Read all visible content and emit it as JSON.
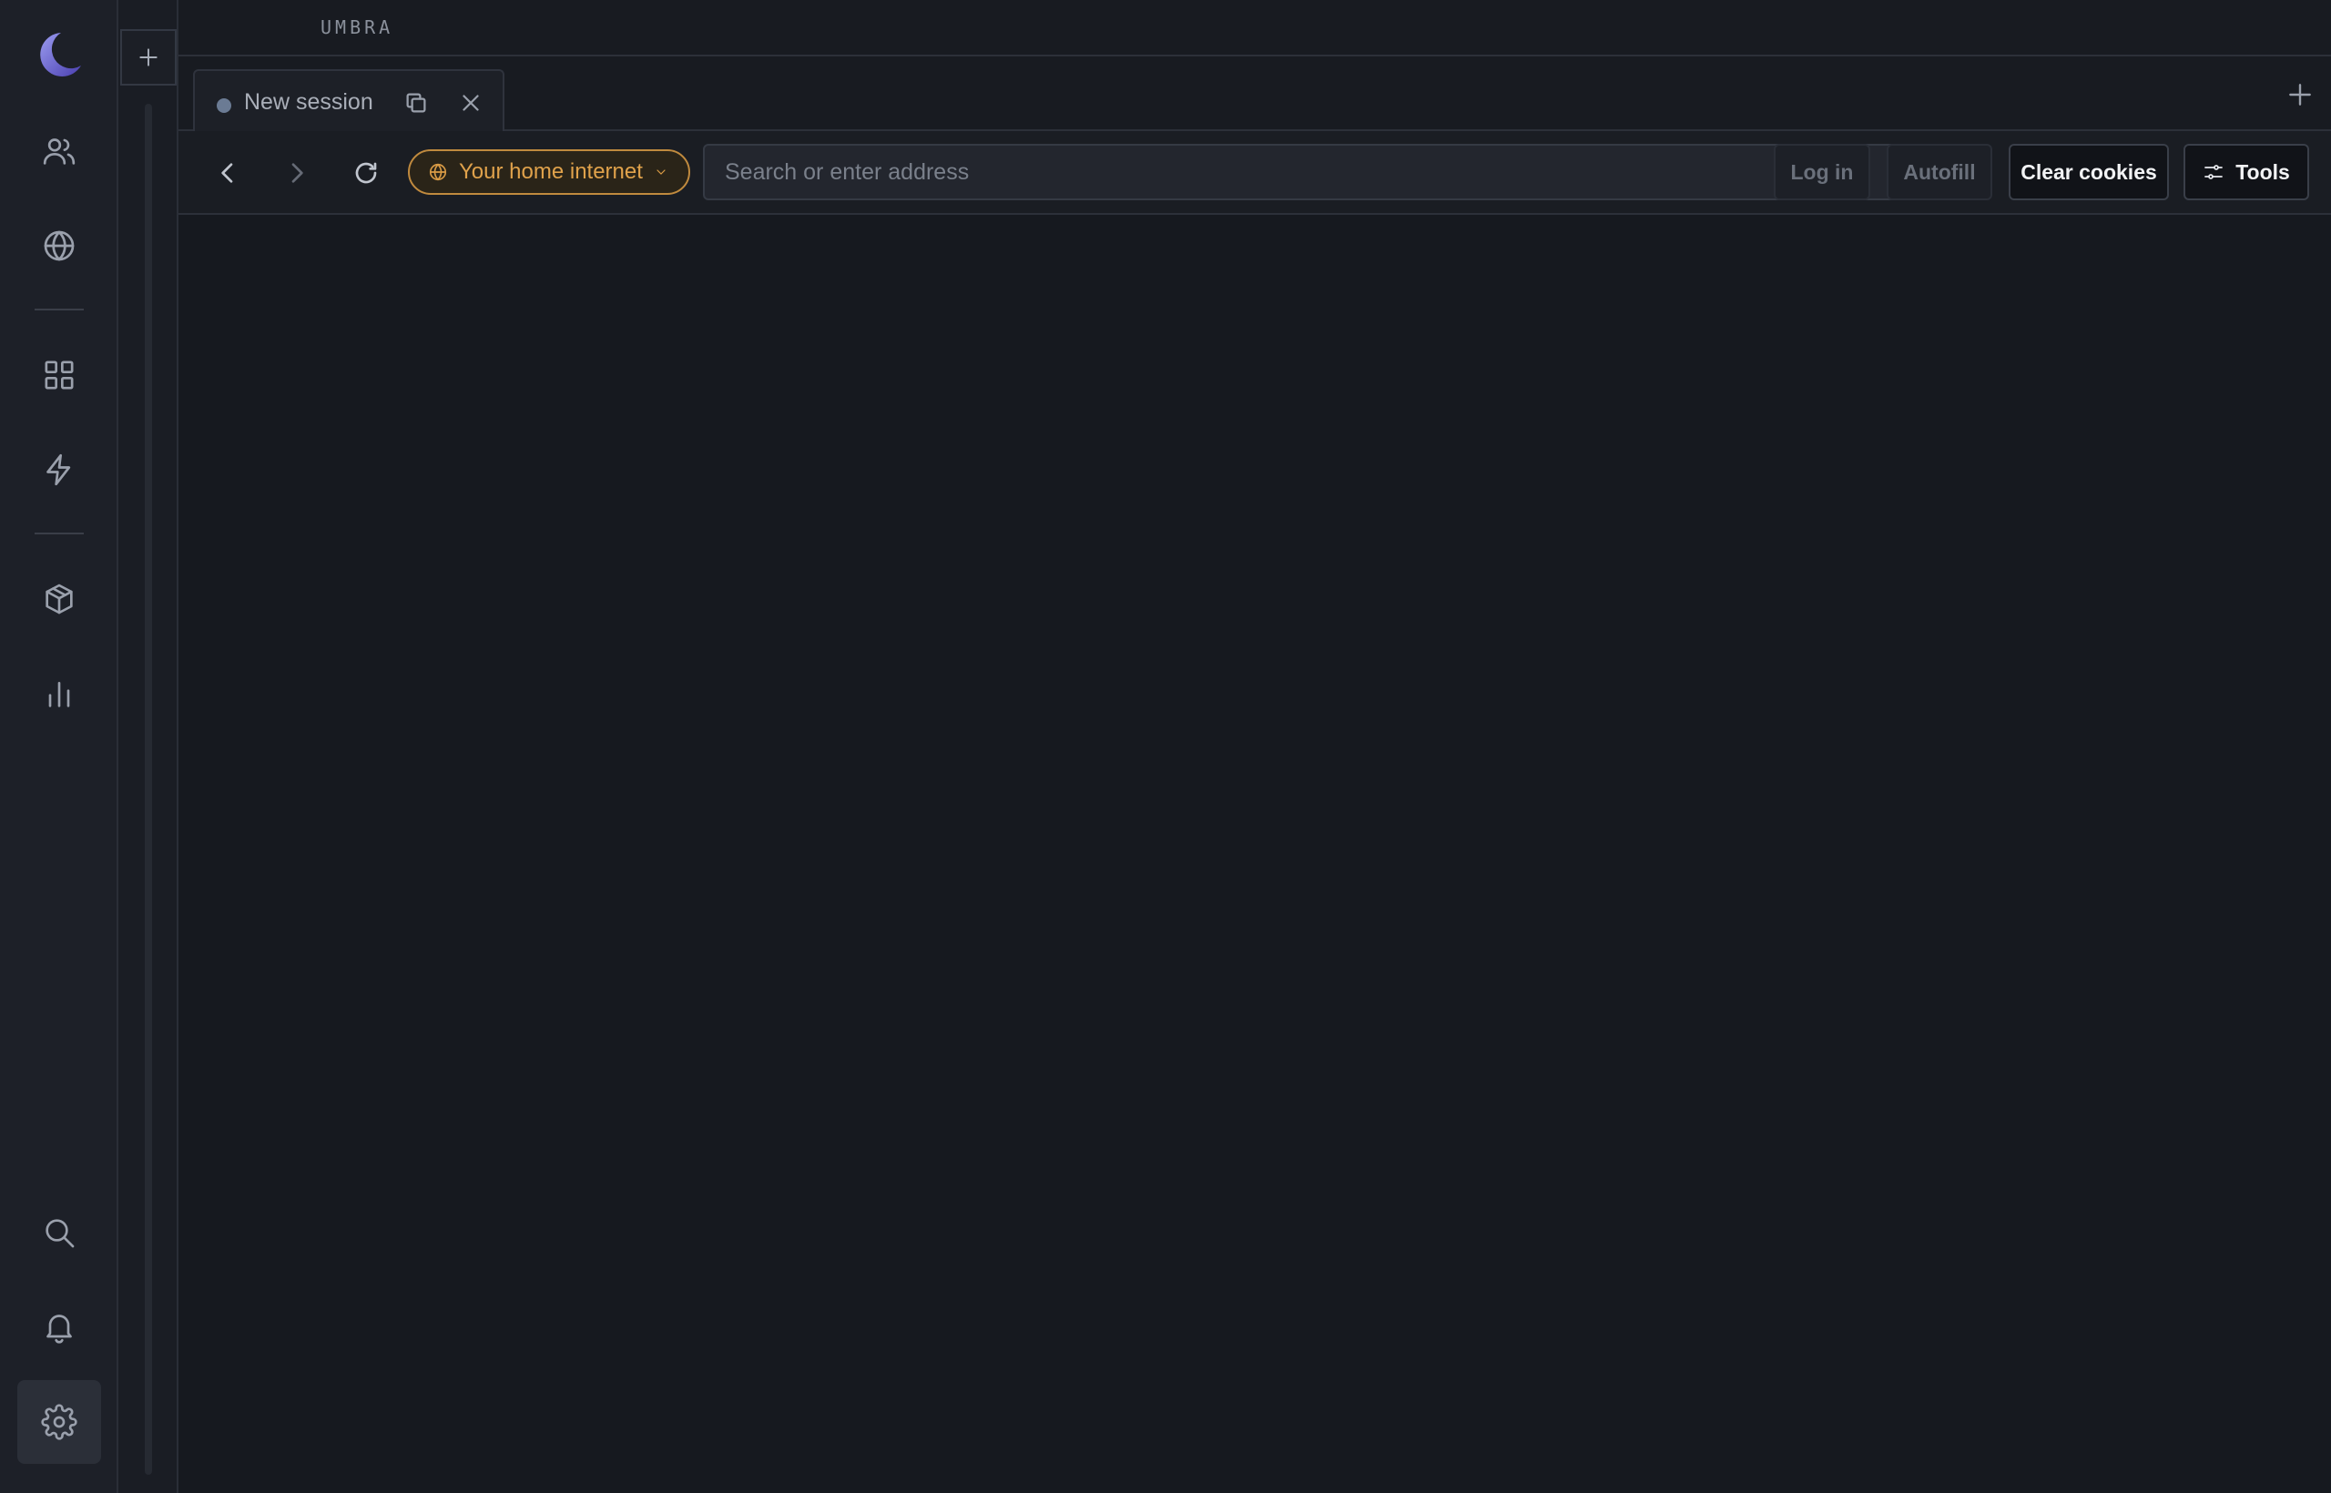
{
  "app": {
    "brand": "UMBRA"
  },
  "rail": {
    "items": [
      {
        "name": "people-icon"
      },
      {
        "name": "globe-icon"
      },
      {
        "name": "grid-icon"
      },
      {
        "name": "bolt-icon"
      },
      {
        "name": "box-icon"
      },
      {
        "name": "bar-chart-icon"
      },
      {
        "name": "search-icon"
      },
      {
        "name": "bell-icon"
      },
      {
        "name": "gear-icon",
        "active": true
      }
    ]
  },
  "tabs": [
    {
      "label": "New session",
      "active": true
    }
  ],
  "toolbar": {
    "proxy_label": "Your home internet",
    "address_placeholder": "Search or enter address",
    "login_label": "Log in",
    "autofill_label": "Autofill",
    "clear_cookies_label": "Clear cookies",
    "tools_label": "Tools"
  },
  "colors": {
    "accent_proxy": "#e0a24b",
    "background": "#16191f",
    "rail": "#1d2028"
  }
}
